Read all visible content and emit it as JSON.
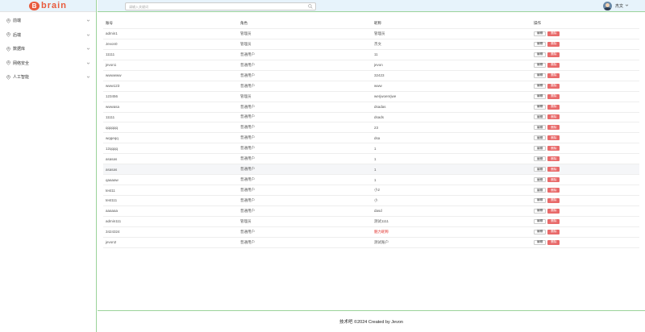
{
  "brand": {
    "mark": "B",
    "text": "brain",
    "color": "#e85a3c"
  },
  "sidebar": {
    "items": [
      {
        "label": "前端",
        "icon": "location-pin-icon"
      },
      {
        "label": "后端",
        "icon": "location-pin-icon"
      },
      {
        "label": "数据库",
        "icon": "location-pin-icon"
      },
      {
        "label": "网络安全",
        "icon": "location-pin-icon"
      },
      {
        "label": "人工智能",
        "icon": "location-pin-icon"
      }
    ]
  },
  "header": {
    "search_placeholder": "请输入关键词",
    "user_name": "杰文"
  },
  "table": {
    "columns": [
      "账号",
      "角色",
      "昵称",
      "操作"
    ],
    "edit_label": "编辑",
    "delete_label": "删除",
    "rows": [
      {
        "account": "admin1",
        "role": "管理员",
        "nickname": "管理员"
      },
      {
        "account": "Jevon0",
        "role": "管理员",
        "nickname": "杰文"
      },
      {
        "account": "11111",
        "role": "普通用户",
        "nickname": "11"
      },
      {
        "account": "jevon1",
        "role": "普通用户",
        "nickname": "jevon"
      },
      {
        "account": "wwwwww",
        "role": "普通用户",
        "nickname": "32423"
      },
      {
        "account": "www123",
        "role": "普通用户",
        "nickname": "www"
      },
      {
        "account": "123456",
        "role": "管理员",
        "nickname": "werjwoenrjwe"
      },
      {
        "account": "wwwasa",
        "role": "普通用户",
        "nickname": "dsadas"
      },
      {
        "account": "11111",
        "role": "普通用户",
        "nickname": "dsads"
      },
      {
        "account": "qqqqqq",
        "role": "普通用户",
        "nickname": "23"
      },
      {
        "account": "wqqeqq",
        "role": "普通用户",
        "nickname": "dsa"
      },
      {
        "account": "12qqqq",
        "role": "普通用户",
        "nickname": "1"
      },
      {
        "account": "asasas",
        "role": "普通用户",
        "nickname": "1"
      },
      {
        "account": "asasas",
        "role": "普通用户",
        "nickname": "1"
      },
      {
        "account": "qaaaaw",
        "role": "普通用户",
        "nickname": "1"
      },
      {
        "account": "test11",
        "role": "普通用户",
        "nickname": "小2"
      },
      {
        "account": "test111",
        "role": "普通用户",
        "nickname": "小"
      },
      {
        "account": "aaaaaa",
        "role": "普通用户",
        "nickname": "dasd"
      },
      {
        "account": "admin111",
        "role": "管理员",
        "nickname": "测试1111"
      },
      {
        "account": "3424324",
        "role": "普通用户",
        "nickname": "魅力昵称",
        "nickname_red": true
      },
      {
        "account": "jevon2",
        "role": "普通用户",
        "nickname": "测试账户"
      }
    ]
  },
  "footer": {
    "text": "技术吧 ©2024 Created by Jevon"
  },
  "colors": {
    "accent_green": "#9bd39a",
    "header_bg": "#e7f3fb",
    "danger": "#e86a6a"
  }
}
